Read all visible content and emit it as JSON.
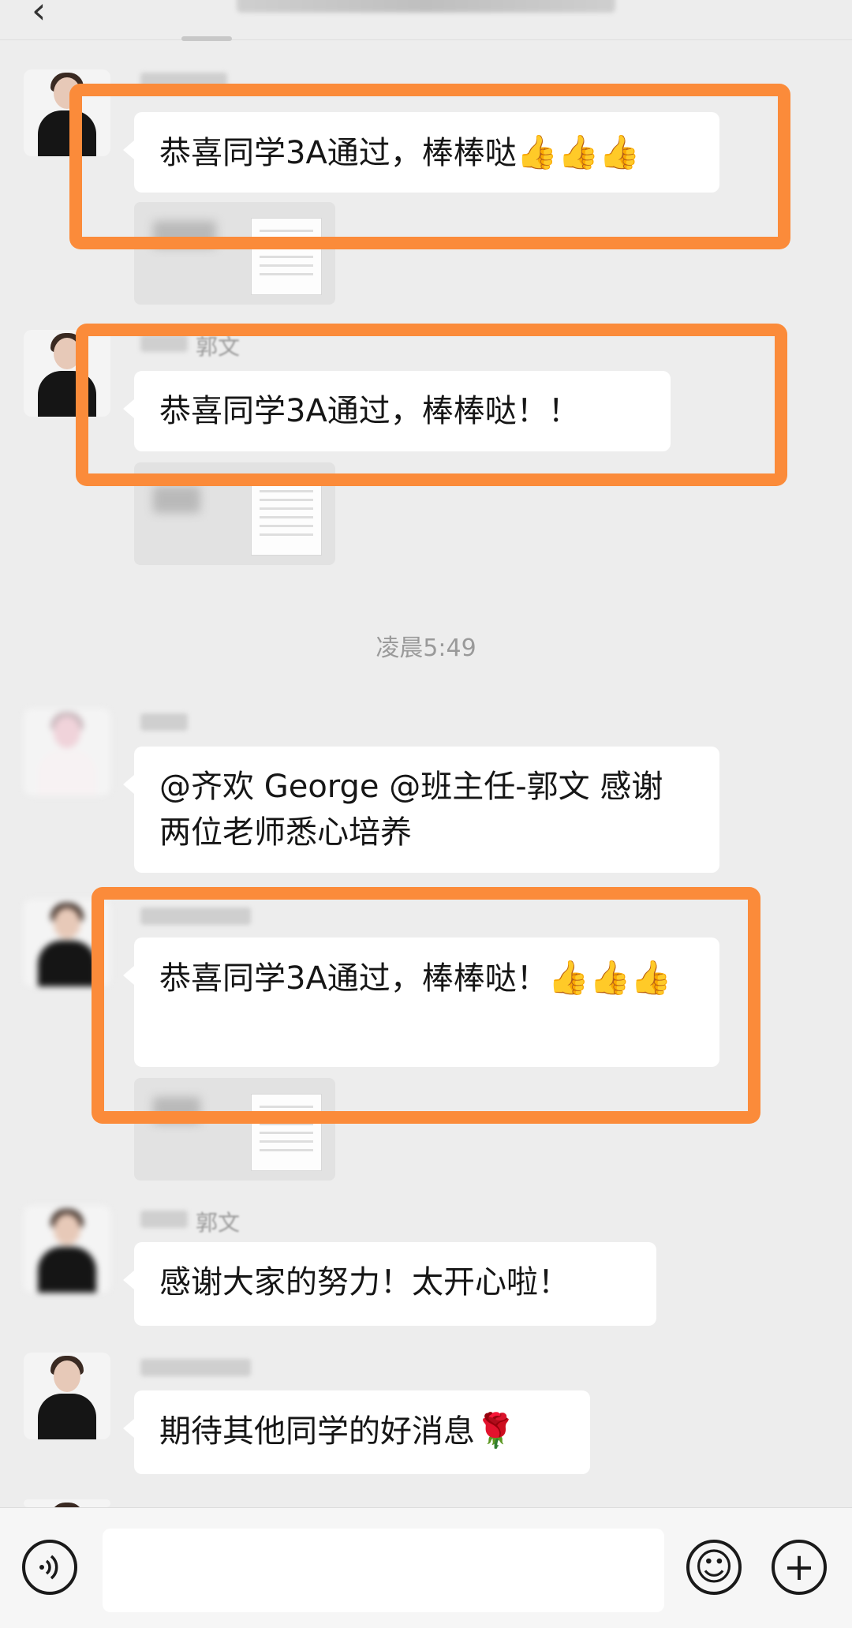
{
  "header": {
    "back_icon": "chevron-left-icon"
  },
  "messages": [
    {
      "text": "恭喜同学3A通过，棒棒哒",
      "emoji": "👍👍👍"
    },
    {
      "text": "恭喜同学3A通过，棒棒哒！！"
    },
    {
      "text": "@齐欢 George @班主任-郭文  感谢两位老师悉心培养"
    },
    {
      "text": "恭喜同学3A通过，棒棒哒！",
      "emoji": "👍👍👍"
    },
    {
      "text": "感谢大家的努力！太开心啦！"
    },
    {
      "text": "期待其他同学的好消息",
      "emoji": "🌹"
    }
  ],
  "partial_nicknames": {
    "second": "郭文",
    "fifth": "郭文"
  },
  "timestamp": "凌晨5:49",
  "highlight_color": "#fb8b3a",
  "bottom_bar": {
    "voice_icon": "voice-icon",
    "emoji_icon": "smiley-icon",
    "plus_icon": "plus-icon",
    "emoji_glyph": "☺",
    "plus_glyph": "+"
  }
}
